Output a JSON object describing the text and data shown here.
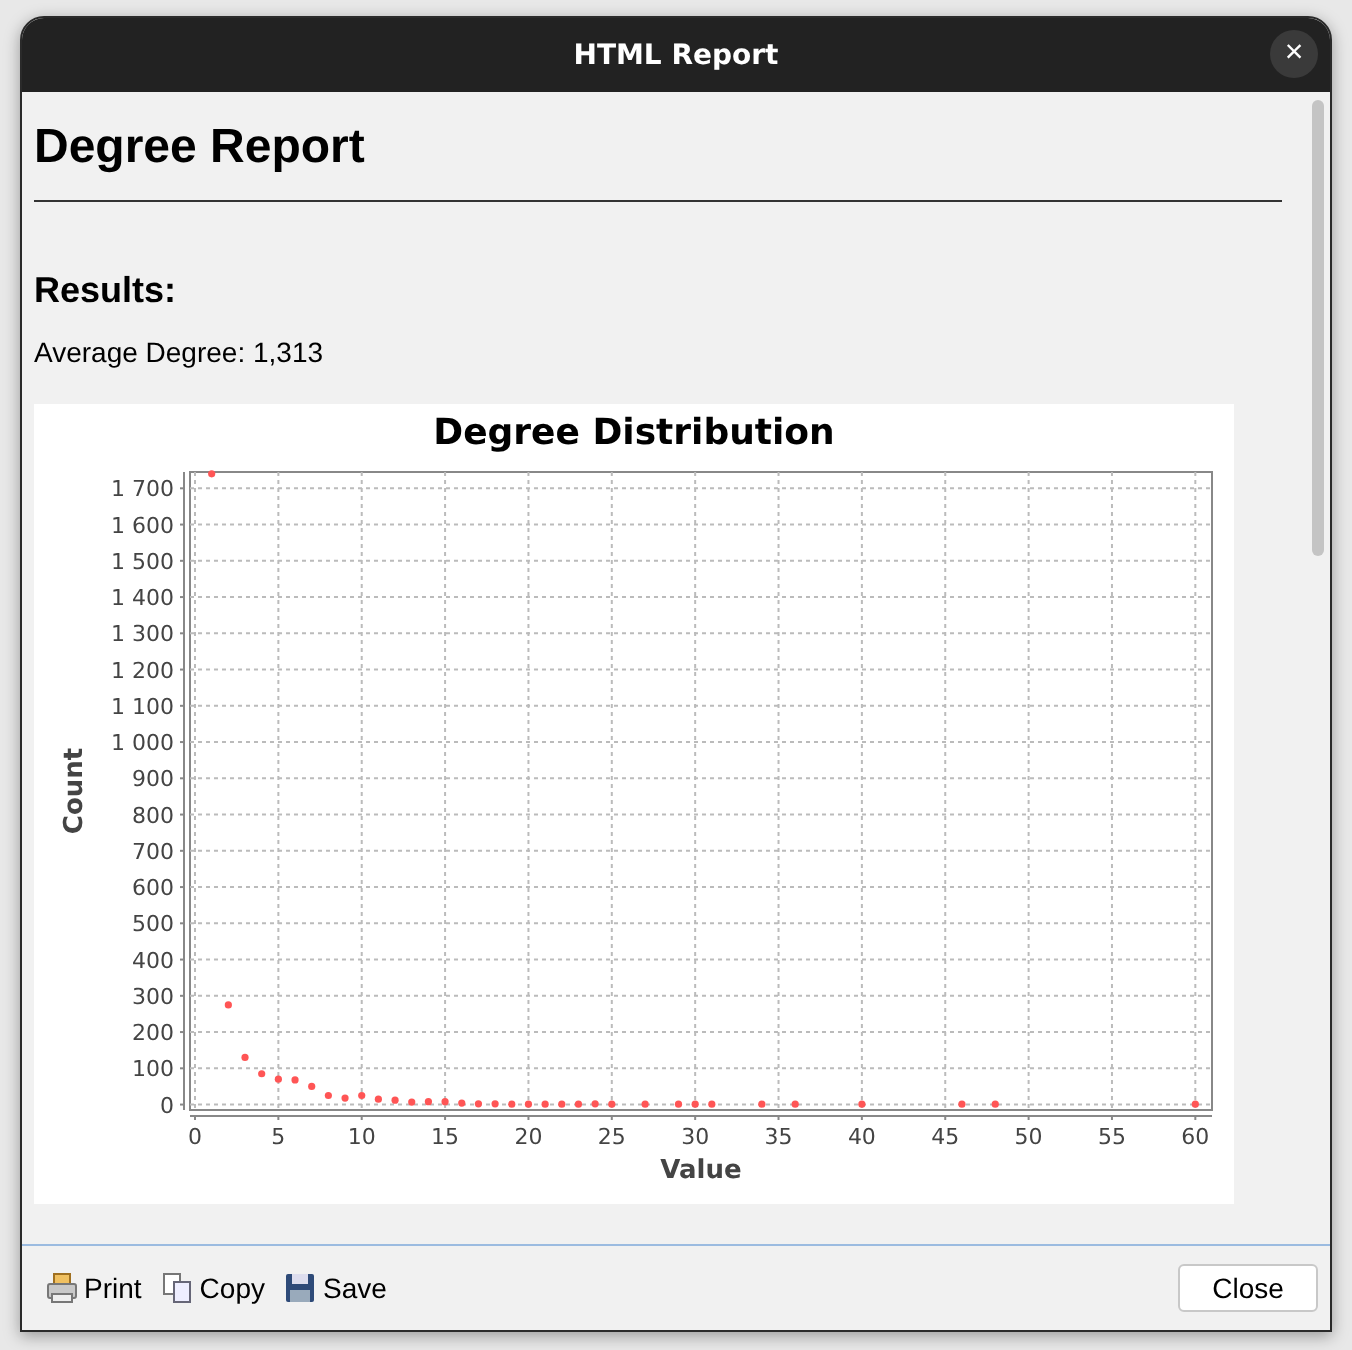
{
  "window": {
    "title": "HTML Report",
    "close_label": "×"
  },
  "report": {
    "title": "Degree Report",
    "section": "Results:",
    "summary": "Average Degree: 1,313",
    "chart_data": {
      "type": "scatter",
      "title": "Degree Distribution",
      "xlabel": "Value",
      "ylabel": "Count",
      "grid": true,
      "series": [
        {
          "color": "#ff5555",
          "x": [
            1,
            2,
            3,
            4,
            5,
            6,
            7,
            8,
            9,
            10,
            11,
            12,
            13,
            14,
            15,
            16,
            17,
            18,
            19,
            20,
            21,
            22,
            23,
            24,
            25,
            27,
            29,
            30,
            31,
            34,
            36,
            40,
            46,
            48,
            60
          ],
          "values": [
            1740,
            275,
            130,
            85,
            70,
            68,
            50,
            25,
            18,
            25,
            15,
            12,
            7,
            8,
            8,
            4,
            2,
            2,
            1,
            1,
            1,
            1,
            1,
            2,
            1,
            1,
            1,
            1,
            1,
            1,
            1,
            1,
            1,
            1,
            1
          ]
        }
      ],
      "xlim": [
        -0.3,
        61
      ],
      "ylim": [
        -15,
        1745
      ],
      "xticks": [
        0,
        5,
        10,
        15,
        20,
        25,
        30,
        35,
        40,
        45,
        50,
        55,
        60
      ],
      "yticks": [
        {
          "value": 0,
          "label": "0"
        },
        {
          "value": 100,
          "label": "100"
        },
        {
          "value": 200,
          "label": "200"
        },
        {
          "value": 300,
          "label": "300"
        },
        {
          "value": 400,
          "label": "400"
        },
        {
          "value": 500,
          "label": "500"
        },
        {
          "value": 600,
          "label": "600"
        },
        {
          "value": 700,
          "label": "700"
        },
        {
          "value": 800,
          "label": "800"
        },
        {
          "value": 900,
          "label": "900"
        },
        {
          "value": 1000,
          "label": "1 000"
        },
        {
          "value": 1100,
          "label": "1 100"
        },
        {
          "value": 1200,
          "label": "1 200"
        },
        {
          "value": 1300,
          "label": "1 300"
        },
        {
          "value": 1400,
          "label": "1 400"
        },
        {
          "value": 1500,
          "label": "1 500"
        },
        {
          "value": 1600,
          "label": "1 600"
        },
        {
          "value": 1700,
          "label": "1 700"
        }
      ]
    }
  },
  "footer": {
    "actions": [
      {
        "kind": "print",
        "label": "Print"
      },
      {
        "kind": "copy",
        "label": "Copy"
      },
      {
        "kind": "save",
        "label": "Save"
      }
    ],
    "close_button": "Close"
  }
}
